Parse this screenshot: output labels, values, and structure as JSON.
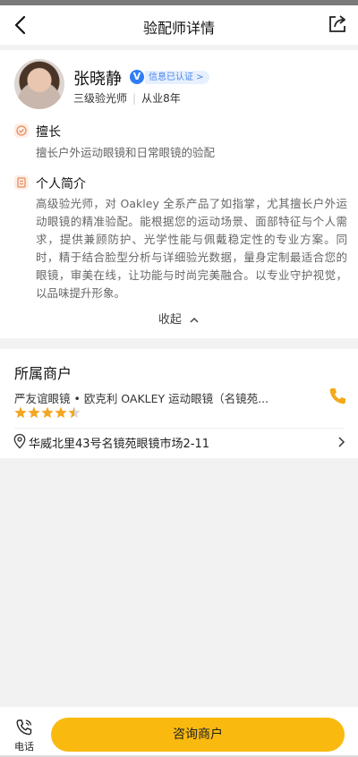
{
  "nav": {
    "title": "验配师详情"
  },
  "profile": {
    "name": "张晓静",
    "verified_label": "信息已认证",
    "level": "三级验光师",
    "experience": "从业8年"
  },
  "specialty": {
    "title": "擅长",
    "text": "擅长户外运动眼镜和日常眼镜的验配"
  },
  "intro": {
    "title": "个人简介",
    "text": "高级验光师，对 Oakley 全系产品了如指掌，尤其擅长户外运动眼镜的精准验配。能根据您的运动场景、面部特征与个人需求，提供兼顾防护、光学性能与佩戴稳定性的专业方案。同时，精于结合脸型分析与详细验光数据，量身定制最适合您的眼镜，审美在线，让功能与时尚完美融合。以专业守护视觉，以品味提升形象。"
  },
  "collapse_label": "收起",
  "merchant": {
    "heading": "所属商户",
    "name": "严友谊眼镜 • 欧克利 OAKLEY 运动眼镜（名镜苑...",
    "rating": 4.5,
    "address": "华威北里43号名镜苑眼镜市场2-11"
  },
  "bottom": {
    "phone_label": "电话",
    "consult_label": "咨询商户"
  },
  "colors": {
    "accent": "#f9b90f",
    "star": "#f5a623",
    "verified": "#2f7df6",
    "section_icon": "#e98a5c"
  }
}
